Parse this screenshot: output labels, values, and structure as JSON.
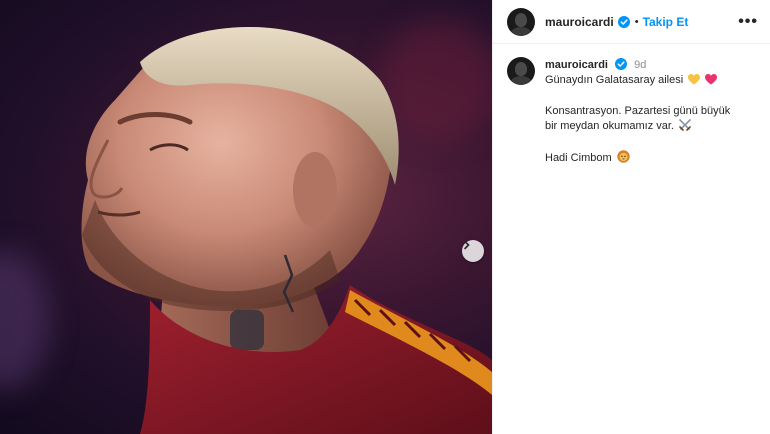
{
  "post": {
    "username": "mauroicardi",
    "follow_label": "Takip Et",
    "separator": "•",
    "more_label": "•••",
    "time_ago": "9d",
    "caption_line1": "Günaydın Galatasaray ailesi",
    "caption_line2": "Konsantrasyon. Pazartesi günü büyük",
    "caption_line3": "bir meydan okumamız var.",
    "caption_line4": "Hadi Cimbom"
  },
  "icons": {
    "verified": "verified-badge-icon",
    "next": "chevron-right-icon",
    "heart_yellow": "yellow-heart-emoji",
    "heart_red": "red-heart-emoji",
    "swords": "crossed-swords-emoji",
    "lion": "lion-face-emoji"
  },
  "colors": {
    "accent": "#0095f6",
    "jersey": "#8e1b2a",
    "jersey_trim": "#e08a1e"
  }
}
